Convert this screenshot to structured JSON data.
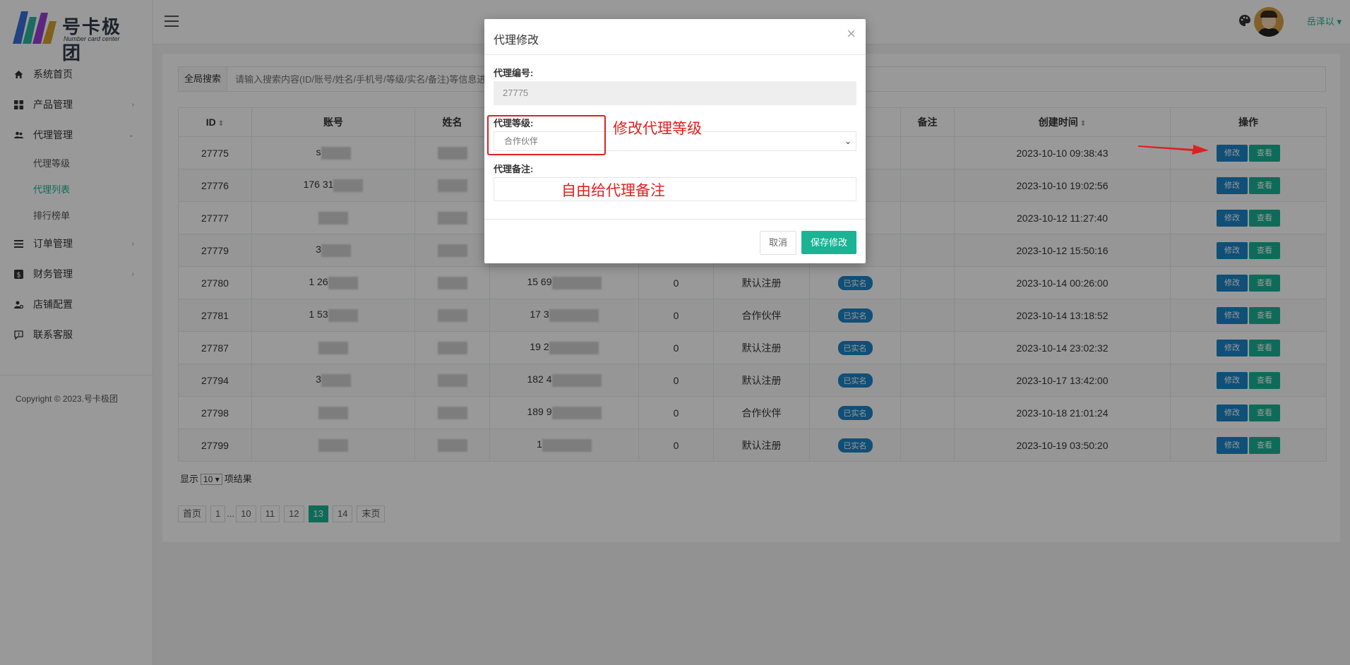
{
  "app": {
    "logo_title": "号卡极团",
    "logo_subtitle": "Number card center",
    "username": "岳泽以 ▾",
    "copyright": "Copyright © 2023.号卡极团"
  },
  "sidebar": {
    "items": [
      {
        "label": "系统首页"
      },
      {
        "label": "产品管理"
      },
      {
        "label": "代理管理"
      },
      {
        "label": "订单管理"
      },
      {
        "label": "财务管理"
      },
      {
        "label": "店铺配置"
      },
      {
        "label": "联系客服"
      }
    ],
    "sub_items": [
      {
        "label": "代理等级"
      },
      {
        "label": "代理列表"
      },
      {
        "label": "排行榜单"
      }
    ]
  },
  "search": {
    "label": "全局搜索",
    "placeholder": "请输入搜索内容(ID/账号/姓名/手机号/等级/实名/备注)等信息进"
  },
  "table": {
    "headers": [
      "ID",
      "账号",
      "姓名",
      "",
      "",
      "",
      "",
      "备注",
      "创建时间",
      "操作"
    ],
    "rows": [
      {
        "id": "27775",
        "account": "s",
        "name": "",
        "phone": "",
        "count": "",
        "level": "",
        "realname": "",
        "created": "2023-10-10 09:38:43"
      },
      {
        "id": "27776",
        "account": "176 31",
        "name": "",
        "phone": "",
        "count": "",
        "level": "",
        "realname": "",
        "created": "2023-10-10 19:02:56"
      },
      {
        "id": "27777",
        "account": "",
        "name": "",
        "phone": "",
        "count": "",
        "level": "",
        "realname": "",
        "created": "2023-10-12 11:27:40"
      },
      {
        "id": "27779",
        "account": "3",
        "name": "",
        "phone": "",
        "count": "",
        "level": "",
        "realname": "",
        "created": "2023-10-12 15:50:16"
      },
      {
        "id": "27780",
        "account": "1 26",
        "name": "",
        "phone": "15 69",
        "count": "0",
        "level": "默认注册",
        "realname": "已实名",
        "created": "2023-10-14 00:26:00"
      },
      {
        "id": "27781",
        "account": "1 53",
        "name": "",
        "phone": "17 3",
        "count": "0",
        "level": "合作伙伴",
        "realname": "已实名",
        "created": "2023-10-14 13:18:52"
      },
      {
        "id": "27787",
        "account": "",
        "name": "",
        "phone": "19 2",
        "count": "0",
        "level": "默认注册",
        "realname": "已实名",
        "created": "2023-10-14 23:02:32"
      },
      {
        "id": "27794",
        "account": "3",
        "name": "",
        "phone": "182 4",
        "count": "0",
        "level": "默认注册",
        "realname": "已实名",
        "created": "2023-10-17 13:42:00"
      },
      {
        "id": "27798",
        "account": "",
        "name": "",
        "phone": "189 9",
        "count": "0",
        "level": "合作伙伴",
        "realname": "已实名",
        "created": "2023-10-18 21:01:24"
      },
      {
        "id": "27799",
        "account": "",
        "name": "",
        "phone": "1",
        "count": "0",
        "level": "默认注册",
        "realname": "已实名",
        "created": "2023-10-19 03:50:20"
      }
    ],
    "edit_label": "修改",
    "view_label": "查看"
  },
  "page_size": {
    "prefix": "显示",
    "value": "10 ▾",
    "suffix": "项结果"
  },
  "pager": {
    "first": "首页",
    "pages": [
      "1",
      "...",
      "10",
      "11",
      "12",
      "13",
      "14"
    ],
    "current": "13",
    "last": "末页"
  },
  "modal": {
    "title": "代理修改",
    "close": "×",
    "id_label": "代理编号:",
    "id_value": "27775",
    "level_label": "代理等级:",
    "level_value": "合作伙伴",
    "remark_label": "代理备注:",
    "remark_value": "",
    "cancel": "取消",
    "save": "保存修改"
  },
  "annotations": {
    "level_note": "修改代理等级",
    "remark_note": "自由给代理备注"
  },
  "colors": {
    "primary": "#1ab394",
    "info": "#1c84c6",
    "annotation": "#e02020"
  }
}
